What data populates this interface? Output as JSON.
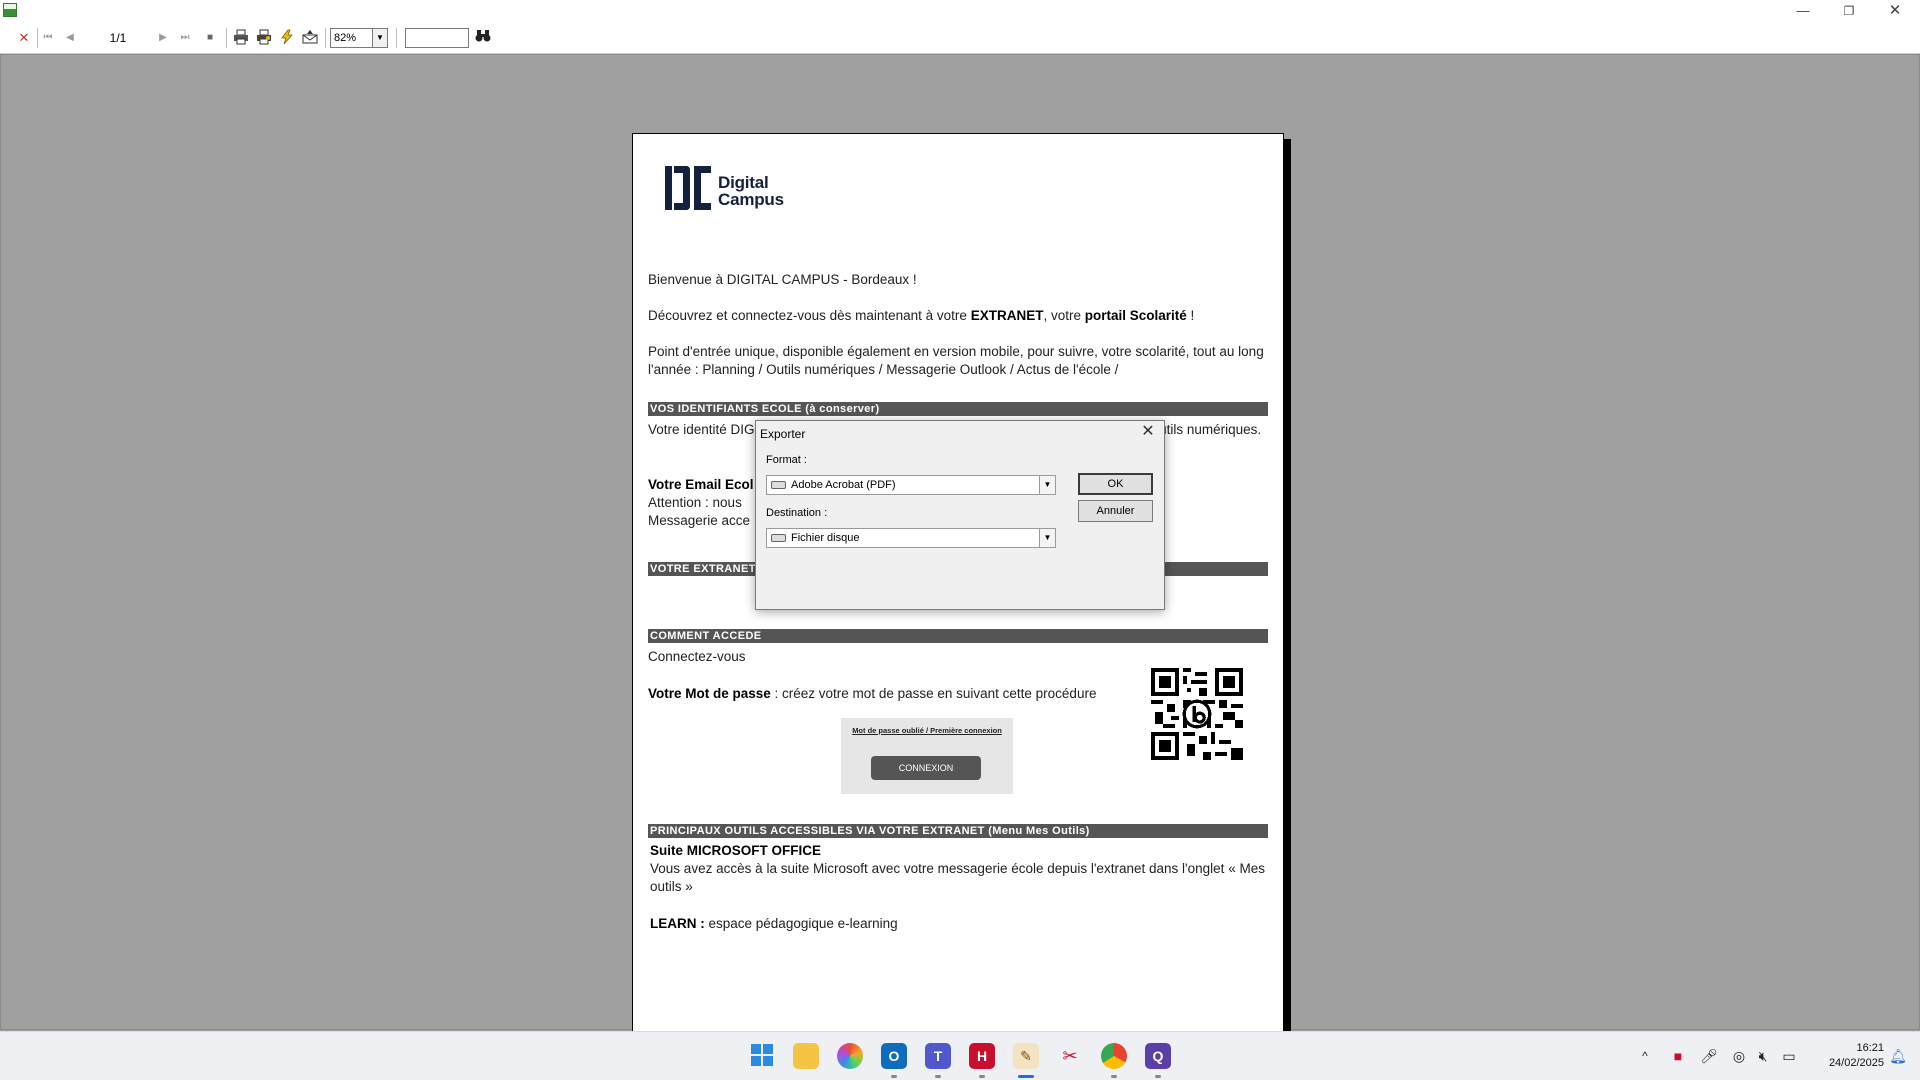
{
  "toolbar": {
    "close_symbol": "✕",
    "first_symbol": "⏮",
    "prev_symbol": "◀",
    "page_indicator": "1/1",
    "next_symbol": "▶",
    "last_symbol": "⏭",
    "stop_symbol": "■",
    "zoom_value": "82%",
    "search_value": ""
  },
  "document": {
    "logo_line1": "Digital",
    "logo_line2": "Campus",
    "welcome": "Bienvenue à DIGITAL CAMPUS - Bordeaux !",
    "discover_pre": "Découvrez et connectez-vous dès maintenant à votre ",
    "discover_b1": "EXTRANET",
    "discover_mid": ", votre ",
    "discover_b2": "portail Scolarité",
    "discover_post": " !",
    "entry_point": "Point d'entrée unique, disponible également en version mobile, pour suivre, votre scolarité, tout au long l'année : Planning / Outils numériques / Messagerie Outlook / Actus de l'école /",
    "section_ids": "VOS IDENTIFIANTS ECOLE (à conserver)",
    "identity_text": "Votre identité DIGITAL CAMPUS - Bordeaux vous permet d'accéder à vos différents outils numériques.",
    "email_label": "Votre Email Ecol",
    "attention_text": "Attention : nous",
    "messagerie_text": "Messagerie acce",
    "section_extranet": "VOTRE EXTRANET",
    "section_how": "COMMENT ACCEDE",
    "connect_text": "Connectez-vous",
    "password_label": "Votre Mot de passe",
    "password_text": " : créez votre mot de passe en suivant cette procédure",
    "forgot_link": "Mot de passe oublié / Première connexion",
    "connect_button": "CONNEXION",
    "section_tools": "PRINCIPAUX OUTILS ACCESSIBLES VIA VOTRE EXTRANET (Menu Mes Outils)",
    "office_title": "Suite MICROSOFT OFFICE",
    "office_text": "Vous avez accès à la suite Microsoft avec votre messagerie école depuis l'extranet dans l'onglet « Mes outils »",
    "learn_label": "LEARN :",
    "learn_text": " espace pédagogique e-learning"
  },
  "dialog": {
    "title": "Exporter",
    "format_label": "Format :",
    "format_value": "Adobe Acrobat (PDF)",
    "destination_label": "Destination :",
    "destination_value": "Fichier disque",
    "ok_label": "OK",
    "cancel_label": "Annuler"
  },
  "taskbar": {
    "time": "16:21",
    "date": "24/02/2025"
  }
}
